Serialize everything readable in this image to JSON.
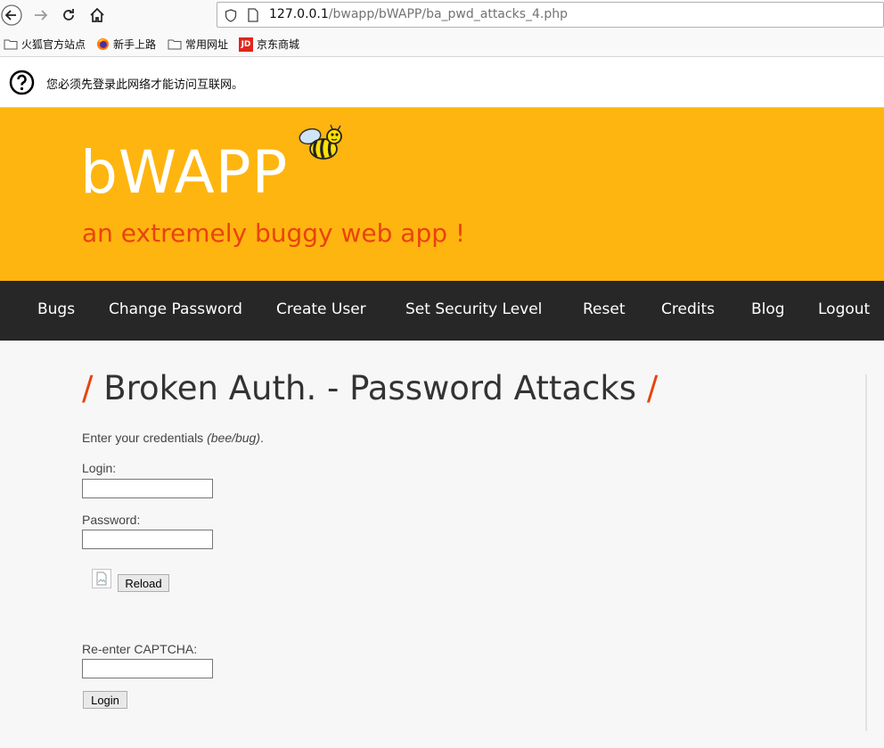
{
  "browser": {
    "url_host": "127.0.0.1",
    "url_path": "/bwapp/bWAPP/ba_pwd_attacks_4.php",
    "bookmarks": [
      {
        "label": "火狐官方站点",
        "icon": "folder-icon"
      },
      {
        "label": "新手上路",
        "icon": "firefox-icon"
      },
      {
        "label": "常用网址",
        "icon": "folder-icon"
      },
      {
        "label": "京东商城",
        "icon": "jd-icon",
        "icon_text": "JD"
      }
    ],
    "notice": "您必须先登录此网络才能访问互联网。"
  },
  "header": {
    "logo": "bWAPP",
    "tagline": "an extremely buggy web app !"
  },
  "menu": [
    {
      "label": "Bugs"
    },
    {
      "label": "Change Password"
    },
    {
      "label": "Create User"
    },
    {
      "label": "Set Security Level"
    },
    {
      "label": "Reset"
    },
    {
      "label": "Credits"
    },
    {
      "label": "Blog"
    },
    {
      "label": "Logout"
    }
  ],
  "main": {
    "title": "Broken Auth. - Password Attacks",
    "slash": "/",
    "intro_text": "Enter your credentials ",
    "intro_hint": "(bee/bug)",
    "intro_end": ".",
    "login_label": "Login:",
    "password_label": "Password:",
    "reload_label": "Reload",
    "captcha_label": "Re-enter CAPTCHA:",
    "submit_label": "Login"
  },
  "colors": {
    "header_bg": "#ffb50f",
    "accent": "#e8430f",
    "menu_bg": "#272727"
  }
}
